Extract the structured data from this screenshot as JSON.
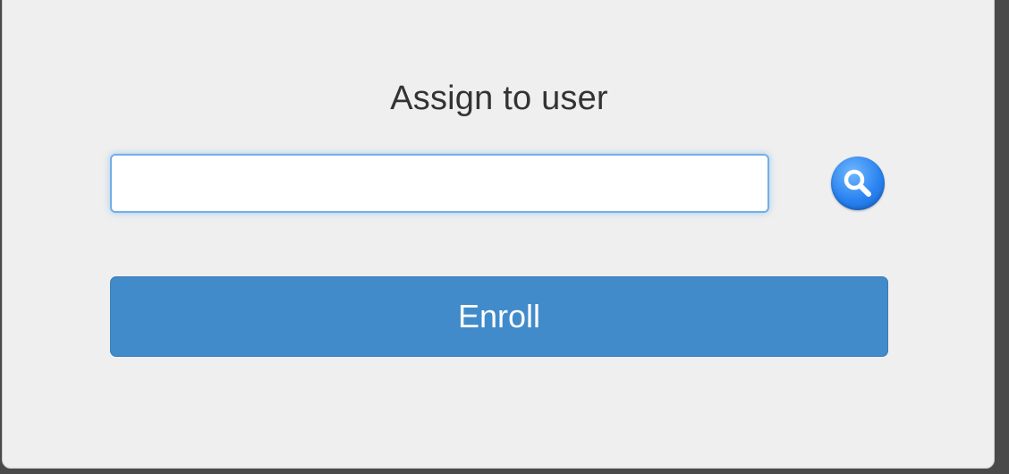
{
  "dialog": {
    "title": "Assign to user",
    "user_input": {
      "value": "",
      "placeholder": ""
    },
    "search_icon": "search-icon",
    "enroll_label": "Enroll"
  },
  "colors": {
    "panel_background": "#efefef",
    "input_focus_border": "#74aee6",
    "search_button": "#2a84f0",
    "enroll_button": "#428bca",
    "enroll_text": "#ffffff"
  }
}
